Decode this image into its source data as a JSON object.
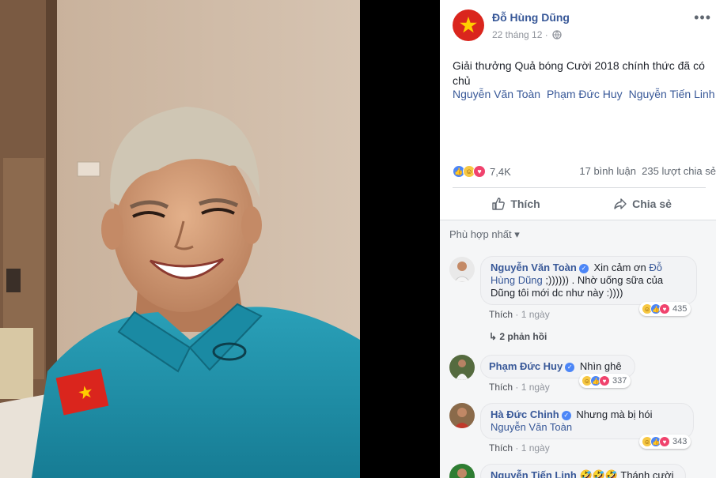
{
  "post": {
    "author": "Đỗ Hùng Dũng",
    "date": "22 tháng 12 ·",
    "more": "•••",
    "text": "Giải thưởng Quả bóng Cười 2018 chính thức đã có chủ",
    "tags": [
      "Nguyễn Văn Toàn",
      "Phạm Đức Huy",
      "Nguyễn Tiến Linh"
    ]
  },
  "stats": {
    "reactions": "7,4K",
    "comments_shares": "17 bình luận  235 lượt chia sẻ"
  },
  "actions": {
    "like": "Thích",
    "share": "Chia sẻ"
  },
  "sort": "Phù hợp nhất ▾",
  "comments": [
    {
      "name": "Nguyễn Văn Toàn",
      "text_a": "Xin cảm ơn",
      "mention": "Đỗ Hùng Dũng",
      "text_b": ";)))))) . Nhờ uống sữa của Dũng tôi mới dc như này :))))",
      "like": "Thích",
      "time": "1 ngày",
      "reacts": "435",
      "replies": "2 phản hồi"
    },
    {
      "name": "Phạm Đức Huy",
      "text": "Nhìn ghê",
      "like": "Thích",
      "time": "1 ngày",
      "reacts": "337"
    },
    {
      "name": "Hà Đức Chinh",
      "text": "Nhưng mà bị hói",
      "mention": "Nguyễn Văn Toàn",
      "like": "Thích",
      "time": "1 ngày",
      "reacts": "343"
    },
    {
      "name": "Nguyễn Tiến Linh",
      "text": "🤣🤣🤣 Thánh cười"
    }
  ],
  "colors": {
    "link": "#385898",
    "like_blue": "#4c86f7",
    "love_red": "#f0436d",
    "haha_yellow": "#f7c843",
    "shirt": "#1e8fa8"
  }
}
